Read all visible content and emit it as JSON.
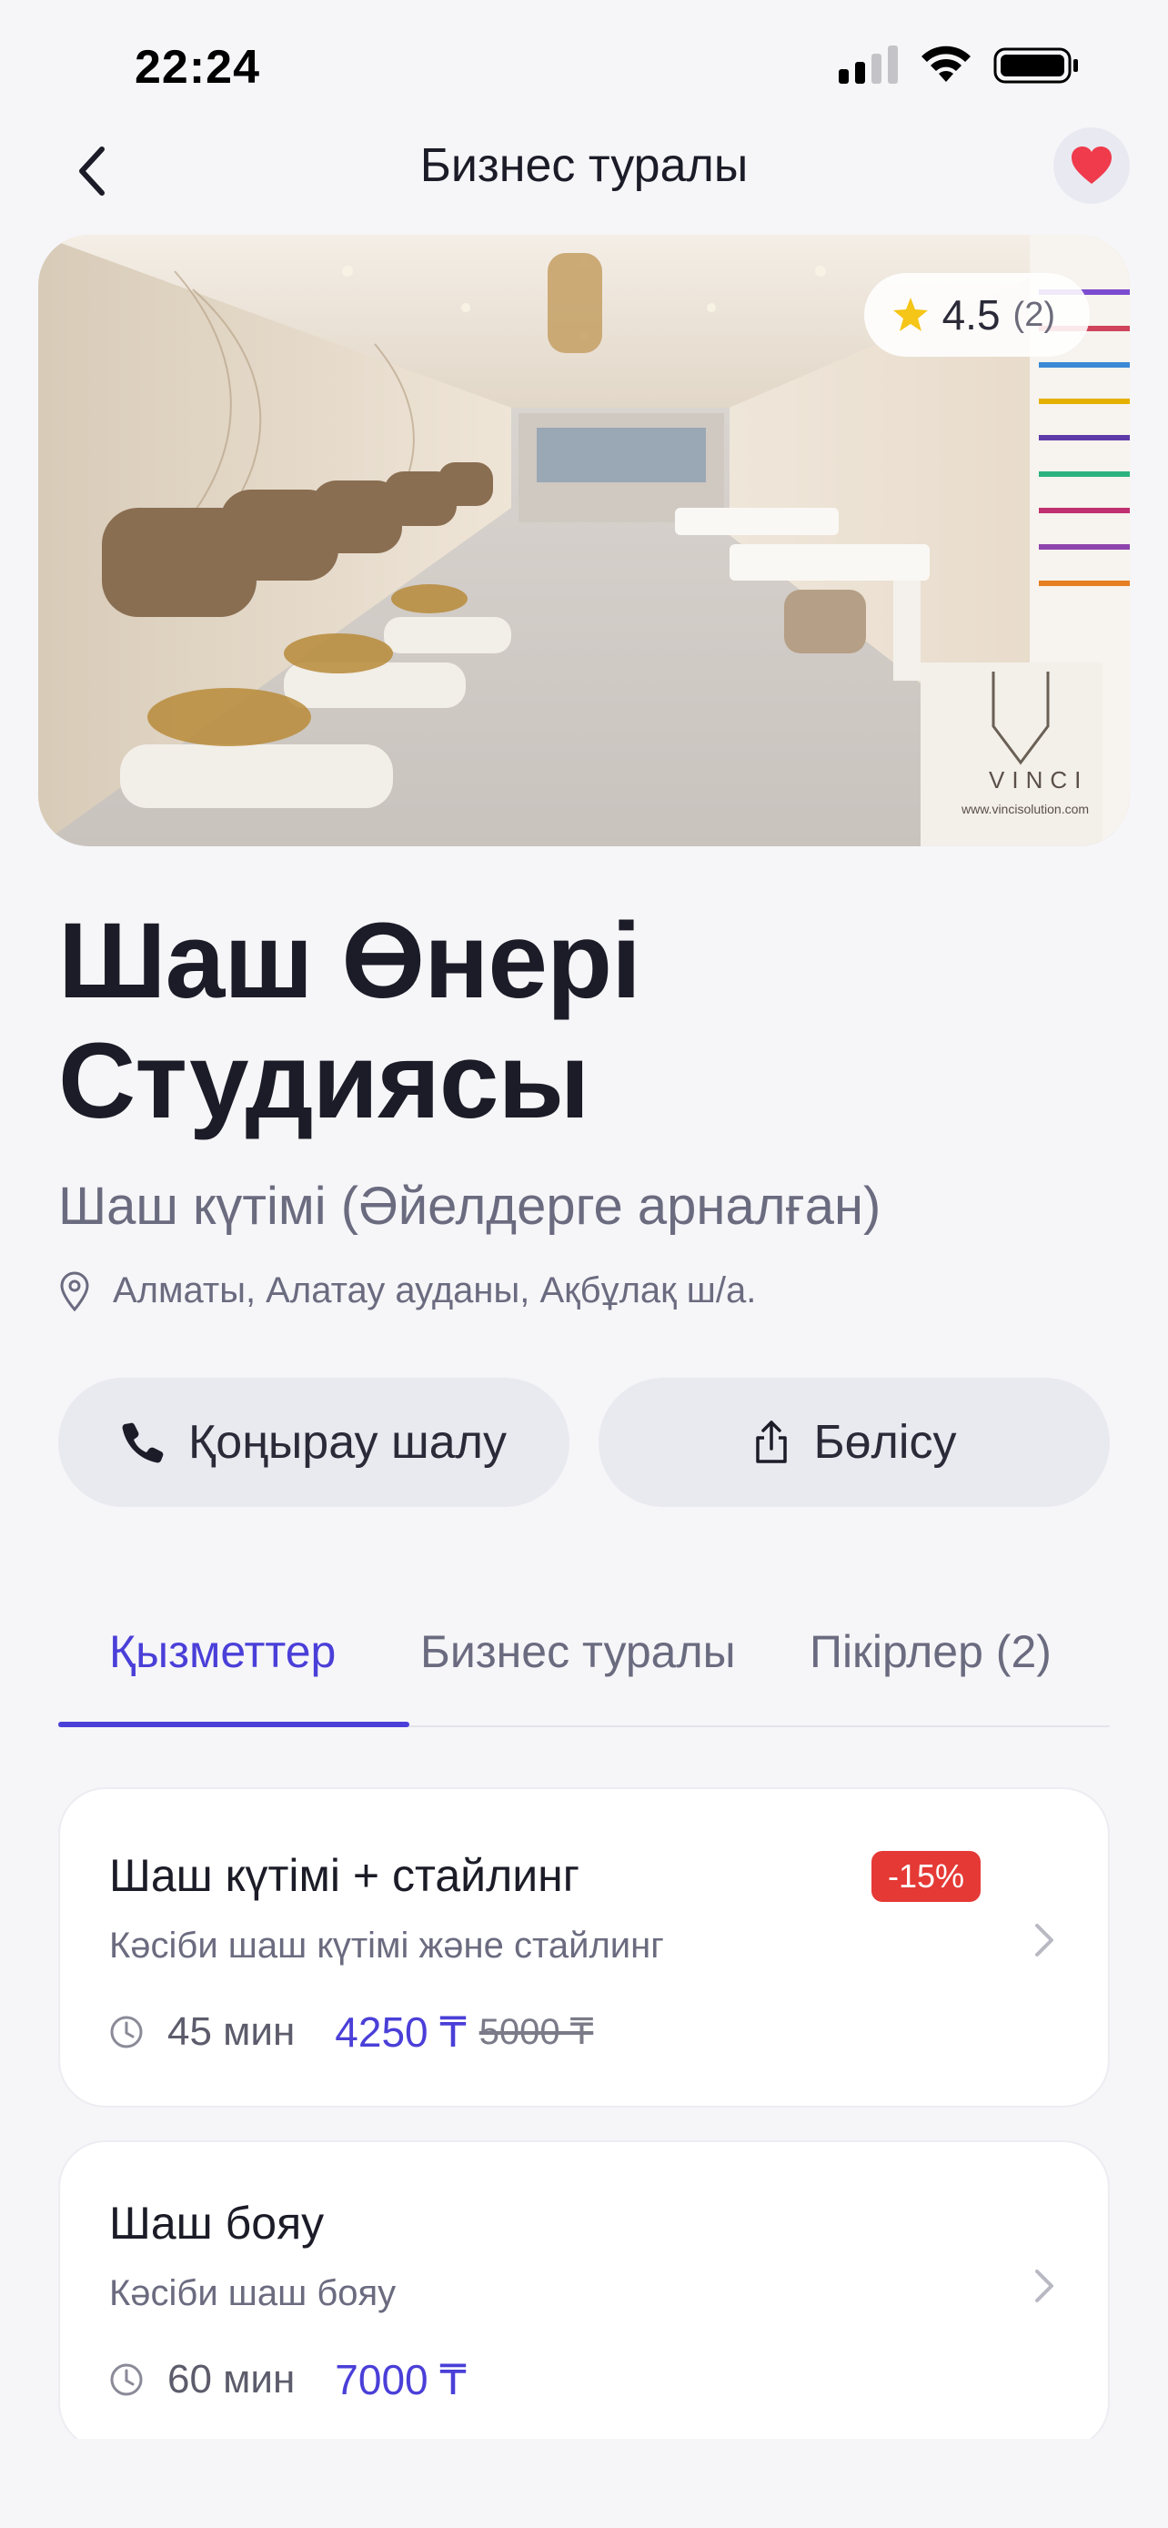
{
  "status_bar": {
    "time": "22:24"
  },
  "nav": {
    "title": "Бизнес туралы"
  },
  "hero": {
    "rating": "4.5",
    "rating_count": "(2)",
    "watermark_brand": "VINCI",
    "watermark_site": "www.vincisolution.com"
  },
  "business": {
    "title": "Шаш Өнері Студиясы",
    "category": "Шаш күтімі (Әйелдерге арналған)",
    "address": "Алматы, Алатау ауданы, Ақбұлақ ш/а."
  },
  "actions": {
    "call_label": "Қоңырау шалу",
    "share_label": "Бөлісу"
  },
  "tabs": [
    {
      "label": "Қызметтер",
      "active": true
    },
    {
      "label": "Бизнес туралы",
      "active": false
    },
    {
      "label": "Пікірлер (2)",
      "active": false
    }
  ],
  "services": [
    {
      "name": "Шаш күтімі + стайлинг",
      "description": "Кәсіби шаш күтімі және стайлинг",
      "duration": "45 мин",
      "price": "4250 ₸",
      "old_price": "5000 ₸",
      "discount": "-15%"
    },
    {
      "name": "Шаш бояу",
      "description": "Кәсіби шаш бояу",
      "duration": "60 мин",
      "price": "7000 ₸"
    }
  ],
  "colors": {
    "accent": "#4a3fd8",
    "favorite": "#ef3b4c",
    "discount": "#e53935",
    "star": "#f5c518",
    "background": "#f6f6f9"
  },
  "icons": [
    "back-chevron-icon",
    "heart-icon",
    "star-icon",
    "location-pin-icon",
    "phone-icon",
    "share-icon",
    "clock-icon",
    "chevron-right-icon"
  ]
}
